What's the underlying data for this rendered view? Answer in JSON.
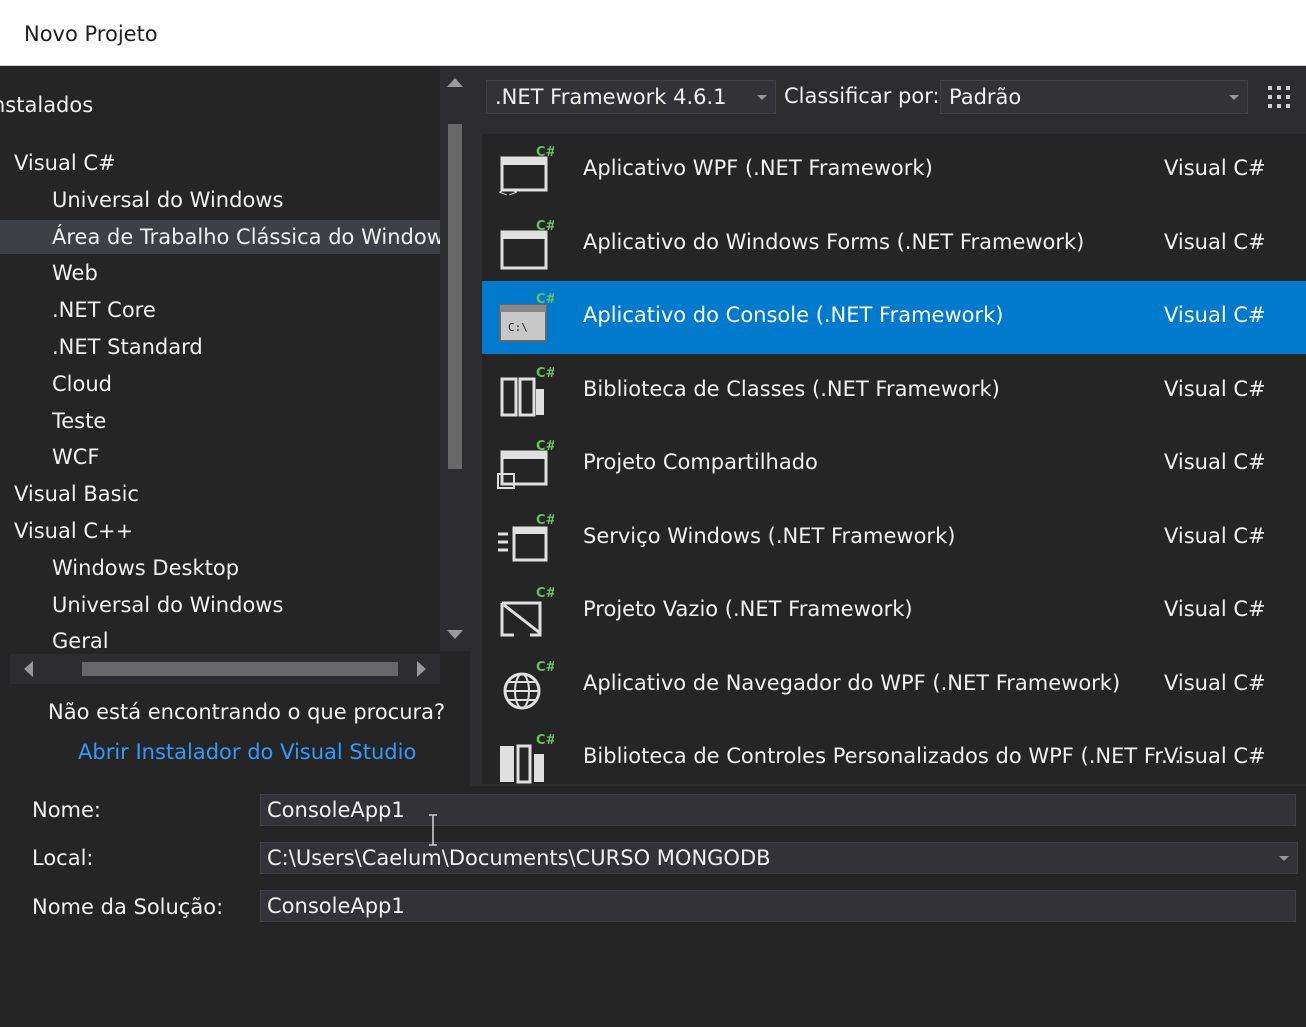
{
  "window": {
    "title": "Novo Projeto"
  },
  "tree": {
    "root": "nstalados",
    "items": [
      {
        "label": "Visual C#",
        "level": 0
      },
      {
        "label": "Universal do Windows",
        "level": 1
      },
      {
        "label": "Área de Trabalho Clássica do Window:",
        "level": 1,
        "selected": true
      },
      {
        "label": "Web",
        "level": 1
      },
      {
        "label": ".NET Core",
        "level": 1
      },
      {
        "label": ".NET Standard",
        "level": 1
      },
      {
        "label": "Cloud",
        "level": 1
      },
      {
        "label": "Teste",
        "level": 1
      },
      {
        "label": "WCF",
        "level": 1
      },
      {
        "label": "Visual Basic",
        "level": 0
      },
      {
        "label": "Visual C++",
        "level": 0
      },
      {
        "label": "Windows Desktop",
        "level": 1
      },
      {
        "label": "Universal do Windows",
        "level": 1
      },
      {
        "label": "Geral",
        "level": 1
      }
    ],
    "not_found": "Não está encontrando o que procura?",
    "installer_link": "Abrir Instalador do Visual Studio"
  },
  "toolbar": {
    "framework": ".NET Framework 4.6.1",
    "sort_label": "Classificar por:",
    "sort_value": "Padrão"
  },
  "templates": [
    {
      "name": "Aplicativo WPF (.NET Framework)",
      "lang": "Visual C#",
      "icon": "wpf-app-icon"
    },
    {
      "name": "Aplicativo do Windows Forms (.NET Framework)",
      "lang": "Visual C#",
      "icon": "winforms-app-icon"
    },
    {
      "name": "Aplicativo do Console (.NET Framework)",
      "lang": "Visual C#",
      "icon": "console-app-icon",
      "selected": true
    },
    {
      "name": "Biblioteca de Classes (.NET Framework)",
      "lang": "Visual C#",
      "icon": "class-library-icon"
    },
    {
      "name": "Projeto Compartilhado",
      "lang": "Visual C#",
      "icon": "shared-project-icon"
    },
    {
      "name": "Serviço Windows (.NET Framework)",
      "lang": "Visual C#",
      "icon": "windows-service-icon"
    },
    {
      "name": "Projeto Vazio (.NET Framework)",
      "lang": "Visual C#",
      "icon": "empty-project-icon"
    },
    {
      "name": "Aplicativo de Navegador do WPF (.NET Framework)",
      "lang": "Visual C#",
      "icon": "wpf-browser-app-icon"
    },
    {
      "name": "Biblioteca de Controles Personalizados do WPF (.NET Fr...",
      "lang": "Visual C#",
      "icon": "wpf-custom-control-library-icon"
    }
  ],
  "form": {
    "name_label": "Nome:",
    "name_value": "ConsoleApp1",
    "location_label": "Local:",
    "location_value": "C:\\Users\\Caelum\\Documents\\CURSO MONGODB",
    "solution_label": "Nome da Solução:",
    "solution_value": "ConsoleApp1"
  },
  "colors": {
    "accent": "#007acc",
    "link": "#3399ff",
    "background": "#252526"
  }
}
